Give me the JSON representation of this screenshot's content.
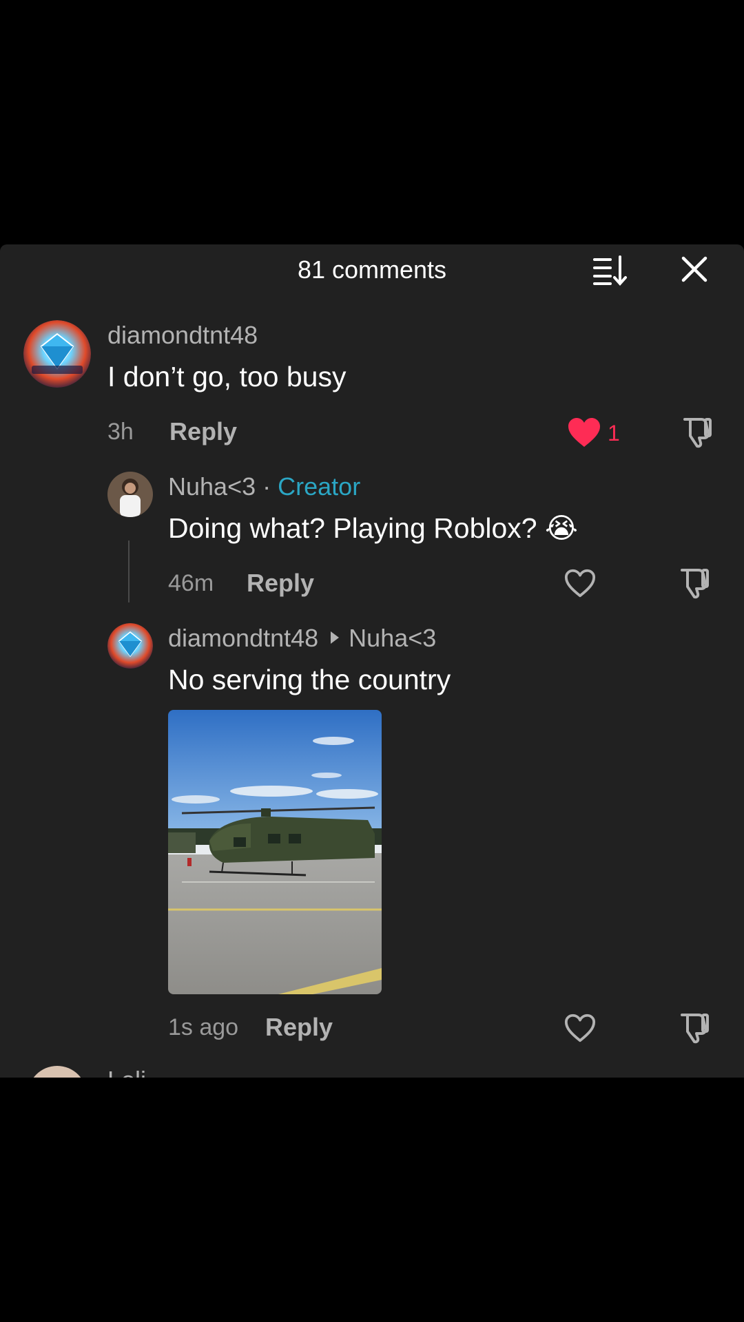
{
  "header": {
    "title": "81 comments",
    "sort_icon": "sort-icon",
    "close_icon": "close-icon"
  },
  "comments": [
    {
      "username": "diamondtnt48",
      "text": "I don’t go, too busy",
      "time": "3h",
      "reply_label": "Reply",
      "likes": "1",
      "liked": true
    }
  ],
  "replies": [
    {
      "username": "Nuha<3",
      "separator": "·",
      "badge": "Creator",
      "text": "Doing what? Playing Roblox? 😭",
      "time": "46m",
      "reply_label": "Reply"
    },
    {
      "username": "diamondtnt48",
      "reply_to": "Nuha<3",
      "text": "No serving the country",
      "time": "1s ago",
      "reply_label": "Reply",
      "has_image": true
    }
  ],
  "next_comment": {
    "username": "Loli"
  },
  "colors": {
    "panel_bg": "#212121",
    "accent_like": "#fe2c55",
    "creator_badge": "#2ba6c4"
  }
}
